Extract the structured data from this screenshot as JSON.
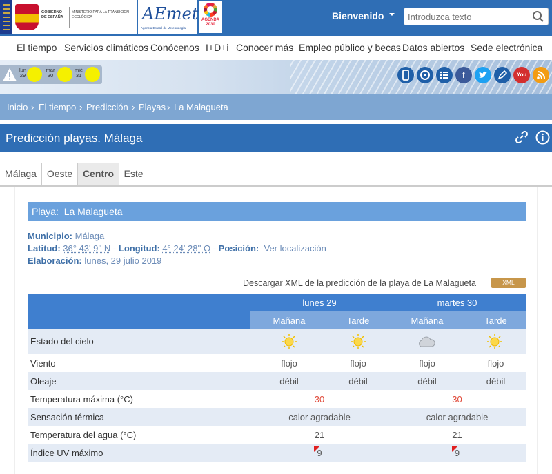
{
  "header": {
    "gobierno_text": "GOBIERNO DE ESPAÑA",
    "ministerio_text": "MINISTERIO PARA LA TRANSICIÓN ECOLÓGICA",
    "aemet_word": "AEmet",
    "aemet_sub": "Agencia Estatal de Meteorología",
    "agenda_text": "AGENDA 2030",
    "welcome": "Bienvenido",
    "search_placeholder": "Introduzca texto"
  },
  "nav": {
    "items": [
      "El tiempo",
      "Servicios climáticos",
      "Conócenos",
      "I+D+i",
      "Conocer más",
      "Empleo público y becas",
      "Datos abiertos",
      "Sede electrónica"
    ]
  },
  "warnings": {
    "days": [
      {
        "day": "lun",
        "num": "29"
      },
      {
        "day": "mar",
        "num": "30"
      },
      {
        "day": "mié",
        "num": "31"
      }
    ]
  },
  "social": [
    "mobile-icon",
    "app-icon",
    "list-icon",
    "facebook-icon",
    "twitter-icon",
    "blog-icon",
    "youtube-icon",
    "rss-icon"
  ],
  "breadcrumb": [
    "Inicio",
    "El tiempo",
    "Predicción",
    "Playas",
    "La Malagueta"
  ],
  "page": {
    "title": "Predicción playas. Málaga"
  },
  "tabs": [
    "Málaga",
    "Oeste",
    "Centro",
    "Este"
  ],
  "beach": {
    "bar_label": "Playa:",
    "name": "La Malagueta",
    "municipio_label": "Municipio:",
    "municipio": "Málaga",
    "latitud_label": "Latitud:",
    "latitud": "36° 43' 9'' N",
    "longitud_label": "Longitud:",
    "longitud": "4° 24' 28'' O",
    "posicion_label": "Posición:",
    "posicion_link": "Ver localización",
    "elaboracion_label": "Elaboración:",
    "elaboracion": "lunes, 29 julio 2019",
    "xml_text": "Descargar XML de la predicción de la playa de La Malagueta",
    "xml_badge": "XML"
  },
  "table": {
    "days": [
      "lunes 29",
      "martes 30"
    ],
    "periods": [
      "Mañana",
      "Tarde",
      "Mañana",
      "Tarde"
    ],
    "rows": [
      {
        "label": "Estado del cielo",
        "values": [
          "sun-icon",
          "sun-icon",
          "cloud-icon",
          "sun-icon"
        ]
      },
      {
        "label": "Viento",
        "values": [
          "flojo",
          "flojo",
          "flojo",
          "flojo"
        ]
      },
      {
        "label": "Oleaje",
        "values": [
          "débil",
          "débil",
          "débil",
          "débil"
        ]
      },
      {
        "label": "Temperatura máxima (°C)",
        "values": [
          "30",
          "30"
        ]
      },
      {
        "label": "Sensación térmica",
        "values": [
          "calor agradable",
          "calor agradable"
        ]
      },
      {
        "label": "Temperatura del agua (°C)",
        "values": [
          "21",
          "21"
        ]
      },
      {
        "label": "Índice UV máximo",
        "values": [
          "9",
          "9"
        ]
      }
    ]
  },
  "colors": {
    "primary": "#2f6eb5",
    "header_row": "#3f7fcf",
    "subheader_row": "#7ea8dd",
    "alt_row": "#e4ebf5",
    "sun": "#f5f000",
    "temp_red": "#e04a3a",
    "xml_badge": "#c7964a"
  }
}
